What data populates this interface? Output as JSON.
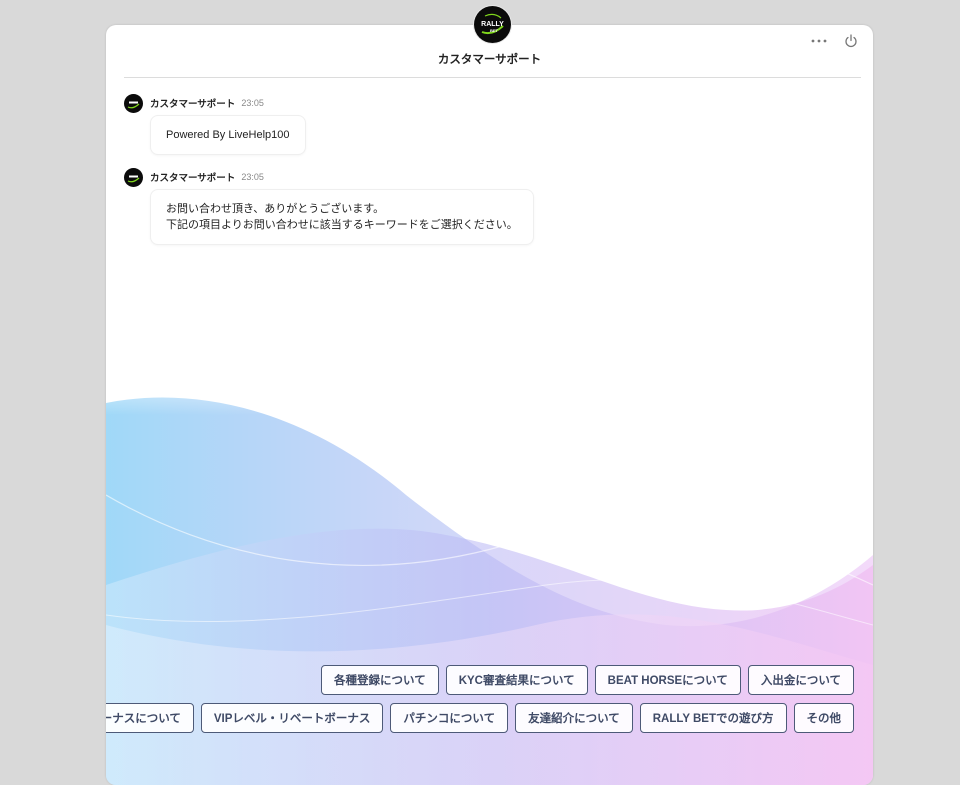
{
  "header": {
    "title": "カスタマーサポート",
    "logo_text_top": "RALLY",
    "logo_text_bottom": "BET"
  },
  "colors": {
    "page_bg": "#d9d9d9",
    "button_border": "#4d5a78",
    "button_text": "#3f4a66",
    "logo_bg": "#0b0b0b",
    "logo_accent": "#7fd61c"
  },
  "icons": {
    "menu": "more-horizontal-icon",
    "power": "power-icon"
  },
  "messages": [
    {
      "sender": "カスタマーサポート",
      "time": "23:05",
      "lines": [
        "Powered By LiveHelp100"
      ]
    },
    {
      "sender": "カスタマーサポート",
      "time": "23:05",
      "lines": [
        "お問い合わせ頂き、ありがとうございます。",
        "下記の項目よりお問い合わせに該当するキーワードをご選択ください。"
      ]
    }
  ],
  "options": {
    "row1": [
      "各種登録について",
      "KYC審査結果について",
      "BEAT HORSEについて",
      "入出金について"
    ],
    "row2": [
      "ボーナスについて",
      "VIPレベル・リベートボーナス",
      "パチンコについて",
      "友達紹介について",
      "RALLY BETでの遊び方",
      "その他"
    ]
  }
}
